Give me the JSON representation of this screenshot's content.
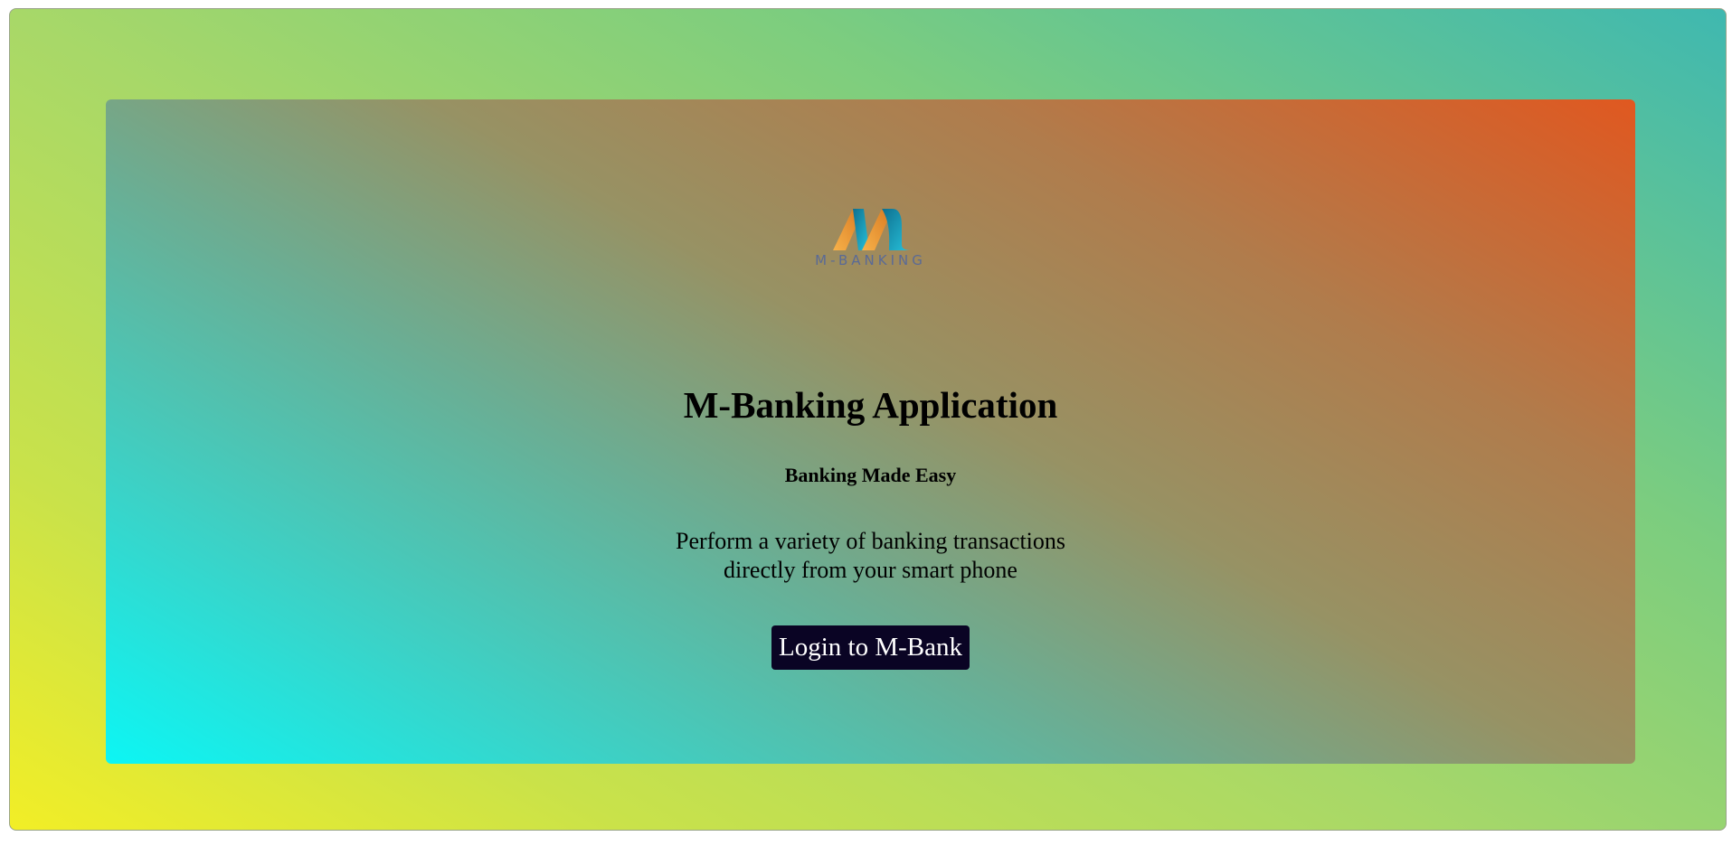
{
  "logo": {
    "icon": "m-banking-logo-icon",
    "text": "M-BANKING"
  },
  "hero": {
    "title": "M-Banking Application",
    "tagline": "Banking Made Easy",
    "description_line1": "Perform a variety of banking transactions",
    "description_line2": "directly from your smart phone",
    "login_label": "Login to M-Bank"
  },
  "colors": {
    "button_bg": "#0a0424",
    "logo_orange": "#f0a040",
    "logo_teal": "#1aa0c0",
    "logo_text": "#5a6a96"
  }
}
